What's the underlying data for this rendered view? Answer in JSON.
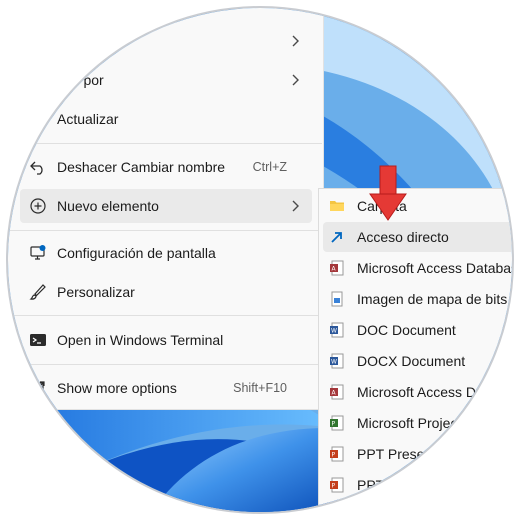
{
  "menu": {
    "top_item": {
      "label": ""
    },
    "sort_by": {
      "label": "lar por"
    },
    "refresh": {
      "label": "Actualizar"
    },
    "undo": {
      "label": "Deshacer Cambiar nombre",
      "shortcut": "Ctrl+Z"
    },
    "new_item": {
      "label": "Nuevo elemento"
    },
    "display": {
      "label": "Configuración de pantalla"
    },
    "personalize": {
      "label": "Personalizar"
    },
    "terminal": {
      "label": "Open in Windows Terminal"
    },
    "more": {
      "label": "Show more options",
      "shortcut": "Shift+F10"
    }
  },
  "submenu": {
    "items": [
      {
        "label": "Carpeta",
        "icon": "folder-icon"
      },
      {
        "label": "Acceso directo",
        "icon": "shortcut-arrow-icon"
      },
      {
        "label": "Microsoft Access Database",
        "icon": "access-icon"
      },
      {
        "label": "Imagen de mapa de bits",
        "icon": "bitmap-icon"
      },
      {
        "label": "DOC Document",
        "icon": "word-icon"
      },
      {
        "label": "DOCX Document",
        "icon": "word-icon"
      },
      {
        "label": "Microsoft Access Data",
        "icon": "access-icon"
      },
      {
        "label": "Microsoft Project D",
        "icon": "project-icon"
      },
      {
        "label": "PPT Presentatio",
        "icon": "powerpoint-icon"
      },
      {
        "label": "PPTX P",
        "icon": "powerpoint-icon"
      }
    ]
  },
  "colors": {
    "accent": "#0067c0",
    "arrow": "#e53935",
    "wallpaper": "#3d8fe0"
  }
}
